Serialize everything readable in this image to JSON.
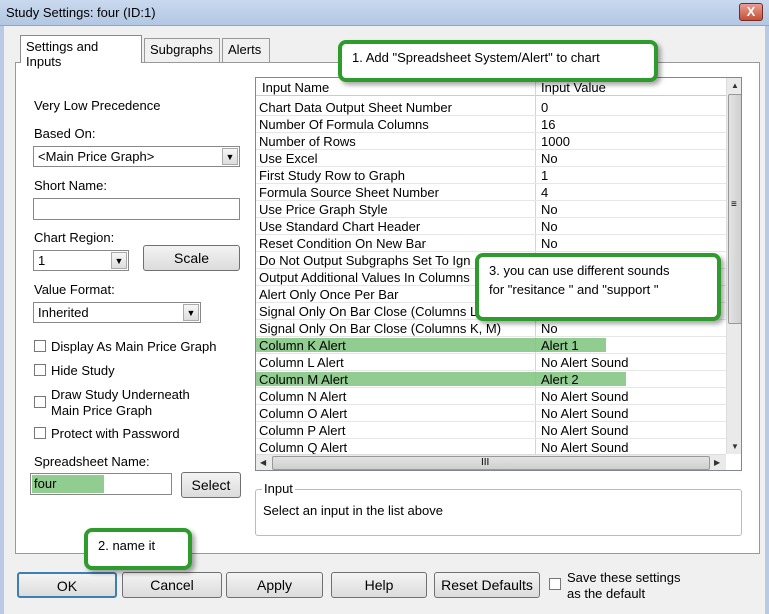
{
  "window": {
    "title": "Study Settings: four (ID:1)",
    "close_label": "X"
  },
  "tabs": [
    "Settings and Inputs",
    "Subgraphs",
    "Alerts"
  ],
  "left": {
    "precedence": "Very Low Precedence",
    "based_on_label": "Based On:",
    "based_on_value": "<Main Price Graph>",
    "short_name_label": "Short Name:",
    "short_name_value": "",
    "chart_region_label": "Chart Region:",
    "chart_region_value": "1",
    "scale_button": "Scale",
    "value_format_label": "Value Format:",
    "value_format_value": "Inherited",
    "checkboxes": [
      "Display As Main Price Graph",
      "Hide Study",
      "Draw Study Underneath",
      "Main Price Graph",
      "Protect with Password"
    ],
    "spreadsheet_name_label": "Spreadsheet Name:",
    "spreadsheet_name_value": "four",
    "select_button": "Select"
  },
  "grid": {
    "headers": [
      "Input Name",
      "Input Value"
    ],
    "rows": [
      [
        "Chart Data Output Sheet Number",
        "0"
      ],
      [
        "Number Of Formula Columns",
        "16"
      ],
      [
        "Number of Rows",
        "1000"
      ],
      [
        "Use Excel",
        "No"
      ],
      [
        "First Study Row to Graph",
        "1"
      ],
      [
        "Formula Source Sheet Number",
        "4"
      ],
      [
        "Use Price Graph Style",
        "No"
      ],
      [
        "Use Standard Chart Header",
        "No"
      ],
      [
        "Reset Condition On New Bar",
        "No"
      ],
      [
        "Do Not Output Subgraphs Set To Ign",
        ""
      ],
      [
        "Output Additional Values In Columns",
        ""
      ],
      [
        "Alert Only Once Per Bar",
        ""
      ],
      [
        "Signal Only On Bar Close (Columns L",
        ""
      ],
      [
        "Signal Only On Bar Close (Columns K, M)",
        "No"
      ],
      [
        "Column K Alert",
        "Alert 1"
      ],
      [
        "Column L Alert",
        "No Alert Sound"
      ],
      [
        "Column M Alert",
        "Alert 2"
      ],
      [
        "Column N Alert",
        "No Alert Sound"
      ],
      [
        "Column O Alert",
        "No Alert Sound"
      ],
      [
        "Column P Alert",
        "No Alert Sound"
      ],
      [
        "Column Q Alert",
        "No Alert Sound"
      ]
    ],
    "hscroll_grip": "III",
    "vscroll_grip": "≡"
  },
  "input_group": {
    "title": "Input",
    "text": "Select an input in the list above"
  },
  "bottom": {
    "ok": "OK",
    "cancel": "Cancel",
    "apply": "Apply",
    "help": "Help",
    "reset": "Reset Defaults",
    "save_line1": "Save these settings",
    "save_line2": "as the default"
  },
  "callouts": {
    "c1": "1. Add \"Spreadsheet System/Alert\"  to chart",
    "c2": "2. name it",
    "c3_line1": "3. you can use different sounds",
    "c3_line2": "for \"resitance \" and \"support \""
  },
  "colors": {
    "highlight": "#7ec47e",
    "callout_border": "#2d9c2d"
  }
}
